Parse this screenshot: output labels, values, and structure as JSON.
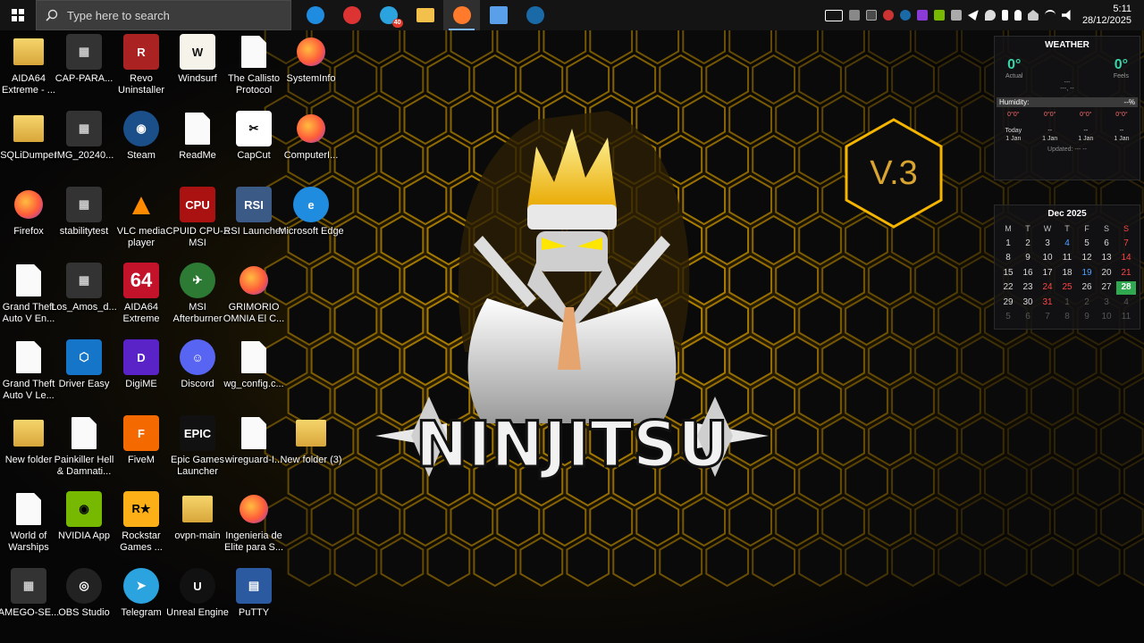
{
  "taskbar": {
    "search_placeholder": "Type here to search",
    "pinned": [
      {
        "name": "edge",
        "icon": "edge-icon",
        "color": "#1f8ce0"
      },
      {
        "name": "screen-recorder",
        "icon": "record-icon",
        "color": "#d33"
      },
      {
        "name": "telegram",
        "icon": "telegram-icon",
        "color": "#2aa3df",
        "badge": "40"
      },
      {
        "name": "file-explorer",
        "icon": "folder-icon",
        "color": "#f2c04b"
      },
      {
        "name": "firefox",
        "icon": "firefox-icon",
        "color": "#ff7b2b"
      },
      {
        "name": "network",
        "icon": "network-icon",
        "color": "#5aa0e8"
      },
      {
        "name": "steam",
        "icon": "steam-icon",
        "color": "#1b6aa8"
      }
    ],
    "clock_time": "5:11",
    "clock_date": "28/12/2025"
  },
  "desktop": {
    "icons": [
      {
        "label": "AIDA64 Extreme - ...",
        "icon": "folder-icon",
        "kind": "folder",
        "col": 0,
        "row": 0
      },
      {
        "label": "CAP-PARA...",
        "icon": "image-icon",
        "kind": "image",
        "col": 1,
        "row": 0
      },
      {
        "label": "Revo Uninstaller",
        "icon": "revo-icon",
        "kind": "revo",
        "col": 2,
        "row": 0
      },
      {
        "label": "Windsurf",
        "icon": "windsurf-icon",
        "kind": "windsurf",
        "col": 3,
        "row": 0
      },
      {
        "label": "The Callisto Protocol",
        "icon": "file-icon",
        "kind": "file",
        "col": 4,
        "row": 0
      },
      {
        "label": "SystemInfo",
        "icon": "firefox-doc-icon",
        "kind": "firefox",
        "col": 5,
        "row": 0
      },
      {
        "label": "SQLiDumper",
        "icon": "folder-icon",
        "kind": "folder",
        "col": 0,
        "row": 1
      },
      {
        "label": "IMG_20240...",
        "icon": "image-icon",
        "kind": "image",
        "col": 1,
        "row": 1
      },
      {
        "label": "Steam",
        "icon": "steam-icon",
        "kind": "steam",
        "col": 2,
        "row": 1
      },
      {
        "label": "ReadMe",
        "icon": "file-icon",
        "kind": "file",
        "col": 3,
        "row": 1
      },
      {
        "label": "CapCut",
        "icon": "capcut-icon",
        "kind": "capcut",
        "col": 4,
        "row": 1
      },
      {
        "label": "ComputerI...",
        "icon": "firefox-doc-icon",
        "kind": "firefox",
        "col": 5,
        "row": 1
      },
      {
        "label": "Firefox",
        "icon": "firefox-icon",
        "kind": "firefox",
        "col": 0,
        "row": 2
      },
      {
        "label": "stabilitytest",
        "icon": "image-icon",
        "kind": "image",
        "col": 1,
        "row": 2
      },
      {
        "label": "VLC media player",
        "icon": "vlc-icon",
        "kind": "vlc",
        "col": 2,
        "row": 2
      },
      {
        "label": "CPUID CPU-Z MSI",
        "icon": "cpuz-icon",
        "kind": "cpuz",
        "col": 3,
        "row": 2
      },
      {
        "label": "RSI Launcher",
        "icon": "rsi-icon",
        "kind": "rsi",
        "col": 4,
        "row": 2
      },
      {
        "label": "Microsoft Edge",
        "icon": "edge-icon",
        "kind": "edge",
        "col": 5,
        "row": 2
      },
      {
        "label": "Grand Theft Auto V En...",
        "icon": "file-icon",
        "kind": "file",
        "col": 0,
        "row": 3
      },
      {
        "label": "Los_Amos_d...",
        "icon": "image-icon",
        "kind": "image",
        "col": 1,
        "row": 3
      },
      {
        "label": "AIDA64 Extreme",
        "icon": "aida-icon",
        "kind": "aida",
        "col": 2,
        "row": 3
      },
      {
        "label": "MSI Afterburner",
        "icon": "afterburner-icon",
        "kind": "afterburner",
        "col": 3,
        "row": 3
      },
      {
        "label": "GRIMORIO OMNIA El C...",
        "icon": "firefox-doc-icon",
        "kind": "firefox",
        "col": 4,
        "row": 3
      },
      {
        "label": "Grand Theft Auto V Le...",
        "icon": "file-icon",
        "kind": "file",
        "col": 0,
        "row": 4
      },
      {
        "label": "Driver Easy",
        "icon": "drivereasy-icon",
        "kind": "drivereasy",
        "col": 1,
        "row": 4
      },
      {
        "label": "DigiME",
        "icon": "digime-icon",
        "kind": "digime",
        "col": 2,
        "row": 4
      },
      {
        "label": "Discord",
        "icon": "discord-icon",
        "kind": "discord",
        "col": 3,
        "row": 4
      },
      {
        "label": "wg_config.c...",
        "icon": "file-icon",
        "kind": "file",
        "col": 4,
        "row": 4
      },
      {
        "label": "New folder",
        "icon": "folder-icon",
        "kind": "folder",
        "col": 0,
        "row": 5
      },
      {
        "label": "Painkiller Hell & Damnati...",
        "icon": "file-icon",
        "kind": "file",
        "col": 1,
        "row": 5
      },
      {
        "label": "FiveM",
        "icon": "fivem-icon",
        "kind": "fivem",
        "col": 2,
        "row": 5
      },
      {
        "label": "Epic Games Launcher",
        "icon": "epic-icon",
        "kind": "epic",
        "col": 3,
        "row": 5
      },
      {
        "label": "wireguard-I...",
        "icon": "file-icon",
        "kind": "file",
        "col": 4,
        "row": 5
      },
      {
        "label": "New folder (3)",
        "icon": "tar-folder-icon",
        "kind": "folder",
        "col": 5,
        "row": 5
      },
      {
        "label": "World of Warships",
        "icon": "file-icon",
        "kind": "file",
        "col": 0,
        "row": 6
      },
      {
        "label": "NVIDIA App",
        "icon": "nvidia-icon",
        "kind": "nvidia",
        "col": 1,
        "row": 6
      },
      {
        "label": "Rockstar Games ...",
        "icon": "rockstar-icon",
        "kind": "rockstar",
        "col": 2,
        "row": 6
      },
      {
        "label": "ovpn-main",
        "icon": "folder-icon",
        "kind": "folder",
        "col": 3,
        "row": 6
      },
      {
        "label": "Ingenieria de Elite para S...",
        "icon": "firefox-doc-icon",
        "kind": "firefox",
        "col": 4,
        "row": 6
      },
      {
        "label": "AMEGO-SE...",
        "icon": "image-icon",
        "kind": "image",
        "col": 0,
        "row": 7
      },
      {
        "label": "OBS Studio",
        "icon": "obs-icon",
        "kind": "obs",
        "col": 1,
        "row": 7
      },
      {
        "label": "Telegram",
        "icon": "telegram-icon",
        "kind": "telegram",
        "col": 2,
        "row": 7
      },
      {
        "label": "Unreal Engine",
        "icon": "unreal-icon",
        "kind": "unreal",
        "col": 3,
        "row": 7
      },
      {
        "label": "PuTTY",
        "icon": "putty-icon",
        "kind": "putty",
        "col": 4,
        "row": 7
      }
    ]
  },
  "wallpaper": {
    "title": "NINJITSU",
    "version": "V.3",
    "accent": "#f5b400"
  },
  "weather": {
    "title": "WEATHER",
    "actual_temp": "0°",
    "actual_label": "Actual",
    "feels_temp": "0°",
    "feels_label": "Feels",
    "condition": "---",
    "wind": "---, --",
    "humidity_label": "Humidity:",
    "humidity_value": "--%",
    "forecast": [
      {
        "lo": "0°",
        "hi": "0°",
        "day": "Today",
        "date": "1 Jan"
      },
      {
        "lo": "0°",
        "hi": "0°",
        "day": "--",
        "date": "1 Jan"
      },
      {
        "lo": "0°",
        "hi": "0°",
        "day": "--",
        "date": "1 Jan"
      },
      {
        "lo": "0°",
        "hi": "0°",
        "day": "--",
        "date": "1 Jan"
      }
    ],
    "updated": "Updated: --- --"
  },
  "calendar": {
    "title": "Dec 2025",
    "weekdays": [
      "M",
      "T",
      "W",
      "T",
      "F",
      "S",
      "S"
    ],
    "days": [
      "1",
      "2",
      "3",
      "4",
      "5",
      "6",
      "7",
      "8",
      "9",
      "10",
      "11",
      "12",
      "13",
      "14",
      "15",
      "16",
      "17",
      "18",
      "19",
      "20",
      "21",
      "22",
      "23",
      "24",
      "25",
      "26",
      "27",
      "28",
      "29",
      "30",
      "31",
      "1",
      "2",
      "3",
      "4",
      "5",
      "6",
      "7",
      "8",
      "9",
      "10",
      "11"
    ],
    "red_days": [
      "24",
      "25",
      "31"
    ],
    "blue_days": [
      "4",
      "19"
    ],
    "today": "28"
  }
}
